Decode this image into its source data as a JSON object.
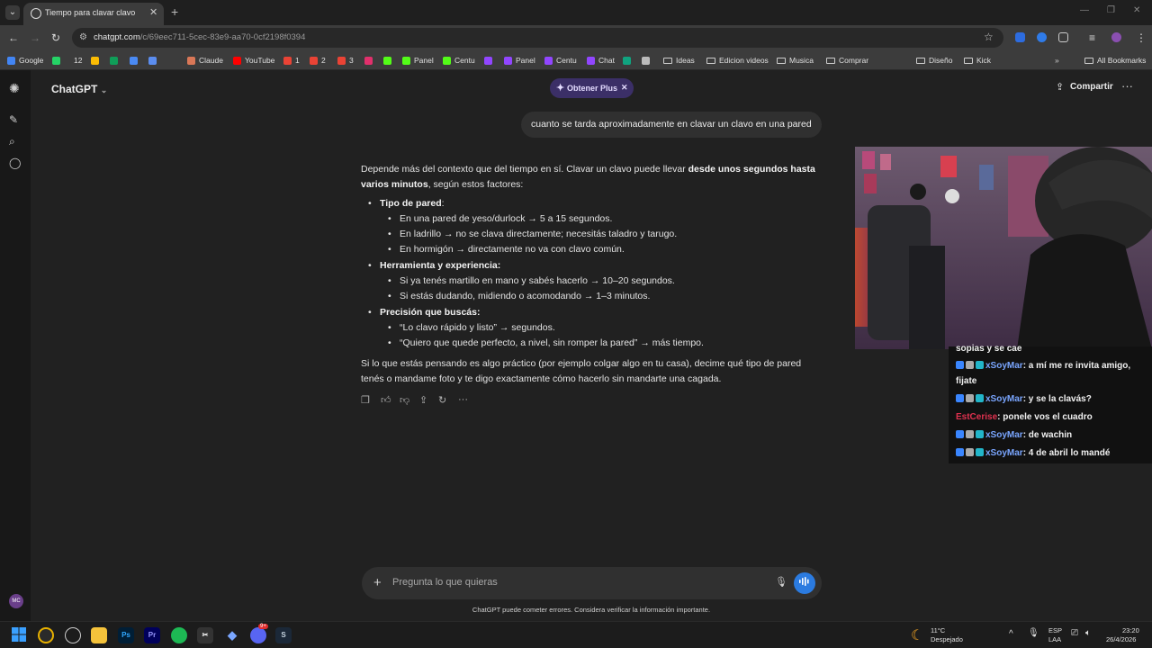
{
  "browser": {
    "tab_title": "Tiempo para clavar clavo",
    "url_host": "chatgpt.com",
    "url_path": "/c/69eec711-5cec-83e9-aa70-0cf2198f0394",
    "bookmarks": [
      {
        "label": "Google",
        "color": "#4285f4"
      },
      {
        "label": "",
        "color": "#25d366"
      },
      {
        "label": "12",
        "color": ""
      },
      {
        "label": "",
        "color": "#fbbc04"
      },
      {
        "label": "",
        "color": "#0f9d58"
      },
      {
        "label": "",
        "color": "#4a8af4"
      },
      {
        "label": "",
        "color": "#5b8def"
      },
      {
        "label": "Claude",
        "color": "#d97757"
      },
      {
        "label": "YouTube",
        "color": "#ff0000"
      },
      {
        "label": "1",
        "color": "#ea4335"
      },
      {
        "label": "2",
        "color": "#ea4335"
      },
      {
        "label": "3",
        "color": "#ea4335"
      },
      {
        "label": "",
        "color": "#e1306c"
      },
      {
        "label": "",
        "color": "#53fc18"
      },
      {
        "label": "Panel",
        "color": "#53fc18"
      },
      {
        "label": "Centu",
        "color": "#53fc18"
      },
      {
        "label": "",
        "color": "#9146ff"
      },
      {
        "label": "Panel",
        "color": "#9146ff"
      },
      {
        "label": "Centu",
        "color": "#9146ff"
      },
      {
        "label": "Chat",
        "color": "#9146ff"
      },
      {
        "label": "",
        "color": "#10a37f"
      },
      {
        "label": "",
        "color": "#bbbbbb"
      }
    ],
    "folders": [
      "Ideas",
      "Edicion videos",
      "Musica",
      "Comprar",
      "Diseño",
      "Kick"
    ],
    "all_bookmarks": "All Bookmarks"
  },
  "app": {
    "model_name": "ChatGPT",
    "plus_label": "Obtener Plus",
    "share_label": "Compartir",
    "user_message": "cuanto se tarda aproximadamente en clavar un clavo en una pared",
    "answer": {
      "intro_a": "Depende más del contexto que del tiempo en sí. Clavar un clavo puede llevar ",
      "intro_bold": "desde unos segundos hasta varios minutos",
      "intro_b": ", según estos factores:",
      "sections": [
        {
          "title": "Tipo de pared",
          "suffix": ":",
          "items": [
            "En una pared de yeso/durlock → 5 a 15 segundos.",
            "En ladrillo → no se clava directamente; necesitás taladro y tarugo.",
            "En hormigón → directamente no va con clavo común."
          ]
        },
        {
          "title": "Herramienta y experiencia:",
          "suffix": "",
          "items": [
            "Si ya tenés martillo en mano y sabés hacerlo → 10–20 segundos.",
            "Si estás dudando, midiendo o acomodando → 1–3 minutos."
          ]
        },
        {
          "title": "Precisión que buscás:",
          "suffix": "",
          "items": [
            "“Lo clavo rápido y listo” → segundos.",
            "“Quiero que quede perfecto, a nivel, sin romper la pared” → más tiempo."
          ]
        }
      ],
      "closing": "Si lo que estás pensando es algo práctico (por ejemplo colgar algo en tu casa), decime qué tipo de pared tenés o mandame foto y te digo exactamente cómo hacerlo sin mandarte una cagada."
    },
    "composer_placeholder": "Pregunta lo que quieras",
    "disclaimer": "ChatGPT puede cometer errores. Considera verificar la información importante.",
    "avatar_initials": "MC"
  },
  "stream_chat": [
    {
      "user": "",
      "text": "sopias y se cae",
      "partial": true
    },
    {
      "user": "xSoyMar",
      "text": ": a mí me re invita amigo,",
      "user_color": "#7aa6ff"
    },
    {
      "user": "",
      "text": "fijate"
    },
    {
      "user": "xSoyMar",
      "text": ": y se la clavás?",
      "user_color": "#7aa6ff"
    },
    {
      "user": "EstCerise",
      "text": ": ponele vos el cuadro",
      "user_color": "#e0314f"
    },
    {
      "user": "xSoyMar",
      "text": ": de wachin",
      "user_color": "#7aa6ff"
    },
    {
      "user": "xSoyMar",
      "text": ": 4 de abril lo mandé",
      "user_color": "#7aa6ff"
    }
  ],
  "taskbar": {
    "weather_temp": "11°C",
    "weather_text": "Despejado",
    "lang_1": "ESP",
    "lang_2": "LAA",
    "time": "23:20",
    "date": "26/4/2026",
    "discord_badge": "9+"
  }
}
